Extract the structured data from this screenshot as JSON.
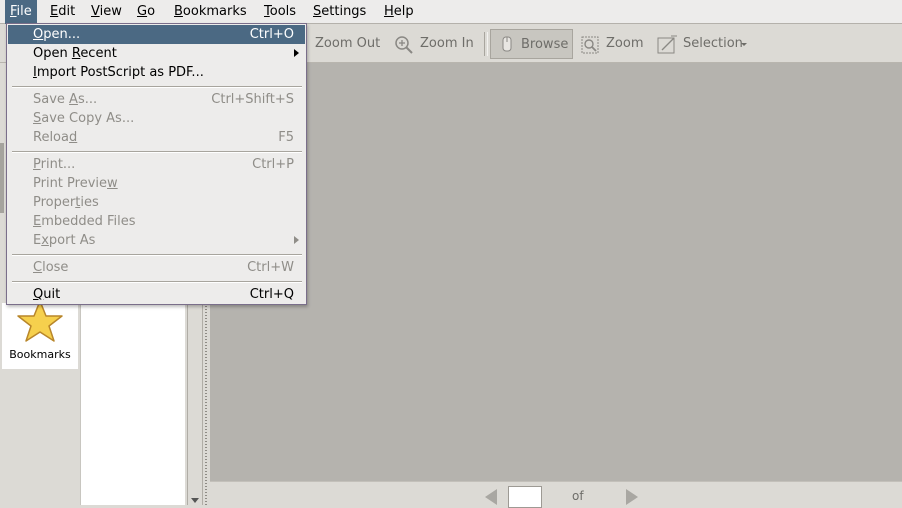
{
  "menubar": {
    "items": [
      {
        "label": "File",
        "mnemonic": "F",
        "rest": "ile"
      },
      {
        "label": "Edit",
        "mnemonic": "E",
        "rest": "dit"
      },
      {
        "label": "View",
        "mnemonic": "V",
        "rest": "iew"
      },
      {
        "label": "Go",
        "mnemonic": "G",
        "rest": "o"
      },
      {
        "label": "Bookmarks",
        "mnemonic": "B",
        "rest": "ookmarks"
      },
      {
        "label": "Tools",
        "mnemonic": "T",
        "rest": "ools"
      },
      {
        "label": "Settings",
        "mnemonic": "S",
        "rest": "ettings"
      },
      {
        "label": "Help",
        "mnemonic": "H",
        "rest": "elp"
      }
    ]
  },
  "toolbar": {
    "zoom_out": "Zoom Out",
    "zoom_in": "Zoom In",
    "browse": "Browse",
    "zoom": "Zoom",
    "selection": "Selection"
  },
  "sidebar": {
    "bookmarks_label": "Bookmarks"
  },
  "pagebar": {
    "page_value": "",
    "of_label": "of"
  },
  "file_menu": {
    "open": {
      "pre": "",
      "mn": "O",
      "post": "pen...",
      "shortcut": "Ctrl+O"
    },
    "open_recent": {
      "pre": "Open ",
      "mn": "R",
      "post": "ecent"
    },
    "import_ps": {
      "pre": "",
      "mn": "I",
      "post": "mport PostScript as PDF..."
    },
    "save_as": {
      "pre": "Save ",
      "mn": "A",
      "post": "s...",
      "shortcut": "Ctrl+Shift+S"
    },
    "save_copy_as": {
      "pre": "",
      "mn": "S",
      "post": "ave Copy As..."
    },
    "reload": {
      "pre": "Reloa",
      "mn": "d",
      "post": "",
      "shortcut": "F5"
    },
    "print": {
      "pre": "",
      "mn": "P",
      "post": "rint...",
      "shortcut": "Ctrl+P"
    },
    "print_preview": {
      "pre": "Print Previe",
      "mn": "w",
      "post": ""
    },
    "properties": {
      "pre": "Proper",
      "mn": "t",
      "post": "ies"
    },
    "embedded_files": {
      "pre": "",
      "mn": "E",
      "post": "mbedded Files"
    },
    "export_as": {
      "pre": "E",
      "mn": "x",
      "post": "port As"
    },
    "close": {
      "pre": "",
      "mn": "C",
      "post": "lose",
      "shortcut": "Ctrl+W"
    },
    "quit": {
      "pre": "",
      "mn": "Q",
      "post": "uit",
      "shortcut": "Ctrl+Q"
    }
  },
  "colors": {
    "highlight": "#4b6983",
    "menubar_bg": "#edeceb",
    "window_bg": "#dcdad5",
    "doc_bg": "#b5b3ae",
    "disabled_text": "#8f8d88"
  }
}
